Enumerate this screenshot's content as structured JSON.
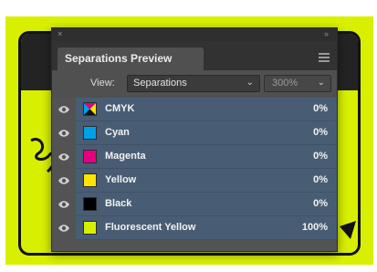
{
  "panel": {
    "close_glyph": "×",
    "collapse_glyph": "»",
    "title": "Separations Preview"
  },
  "view": {
    "label": "View:",
    "mode": "Separations",
    "zoom": "300%"
  },
  "separations": [
    {
      "name": "CMYK",
      "percent": "0%",
      "swatch": "cmyk-composite-icon"
    },
    {
      "name": "Cyan",
      "percent": "0%",
      "swatch_color": "#00a0e9"
    },
    {
      "name": "Magenta",
      "percent": "0%",
      "swatch_color": "#e6007e"
    },
    {
      "name": "Yellow",
      "percent": "0%",
      "swatch_color": "#ffe500"
    },
    {
      "name": "Black",
      "percent": "0%",
      "swatch_color": "#000000"
    },
    {
      "name": "Fluorescent Yellow",
      "percent": "100%",
      "swatch_color": "#d8f000"
    }
  ],
  "colors": {
    "row_selected": "#485d74",
    "background_accent": "#d8f000"
  }
}
